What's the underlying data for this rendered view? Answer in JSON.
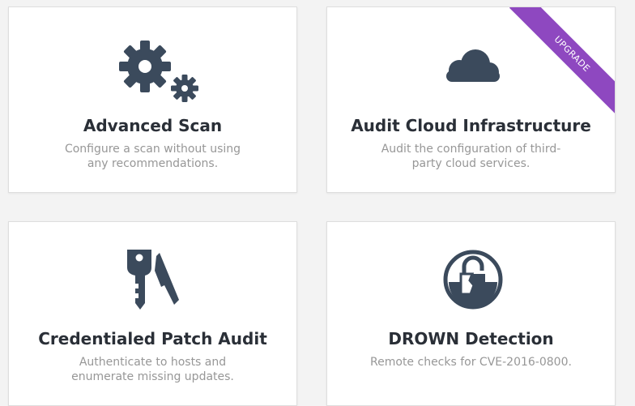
{
  "colors": {
    "icon": "#3b4a5c",
    "title": "#2a2f37",
    "description": "#979797",
    "ribbon": "#8e48c0",
    "background": "#f3f3f3"
  },
  "cards": [
    {
      "title": "Advanced Scan",
      "description": [
        "Configure a scan without using",
        "any recommendations."
      ],
      "icon": "gears-icon"
    },
    {
      "title": "Audit Cloud Infrastructure",
      "description": [
        "Audit the configuration of third-",
        "party cloud services."
      ],
      "icon": "cloud-icon",
      "badge": "UPGRADE"
    },
    {
      "title": "Credentialed Patch Audit",
      "description": [
        "Authenticate to hosts and",
        "enumerate missing updates."
      ],
      "icon": "keys-icon"
    },
    {
      "title": "DROWN Detection",
      "description": [
        "Remote checks for CVE-2016-0800."
      ],
      "icon": "broken-lock-icon"
    }
  ]
}
